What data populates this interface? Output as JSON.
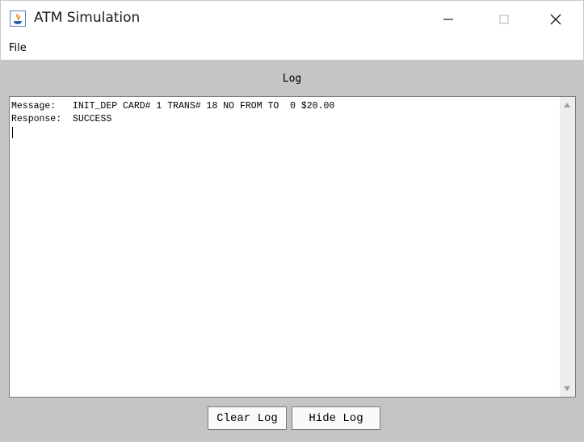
{
  "window": {
    "title": "ATM Simulation",
    "controls": {
      "minimize_icon": "minimize-icon",
      "maximize_icon": "maximize-icon",
      "close_icon": "close-icon"
    }
  },
  "menu": {
    "file": "File"
  },
  "log": {
    "title": "Log",
    "text": "Message:   INIT_DEP CARD# 1 TRANS# 18 NO FROM TO  0 $20.00\nResponse:  SUCCESS"
  },
  "buttons": {
    "clear": "Clear Log",
    "hide": "Hide Log"
  }
}
